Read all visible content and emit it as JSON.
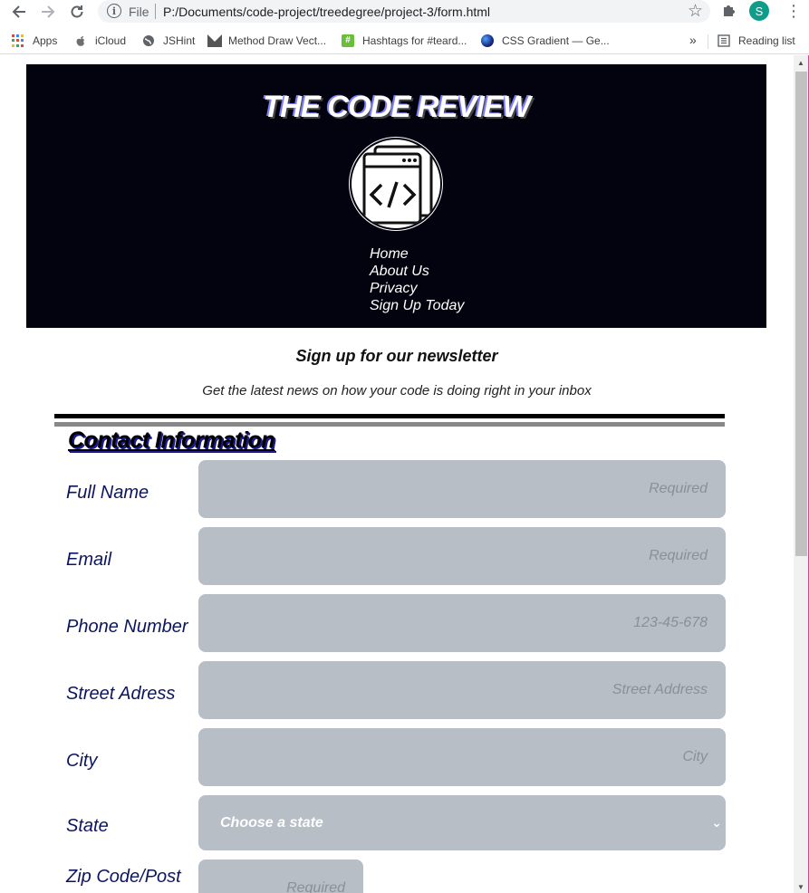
{
  "browser": {
    "file_label": "File",
    "url": "P:/Documents/code-project/treedegree/project-3/form.html",
    "profile_initial": "S",
    "bookmarks": [
      {
        "label": "Apps",
        "icon": "apps-grid-icon"
      },
      {
        "label": "iCloud",
        "icon": "apple-icon"
      },
      {
        "label": "JSHint",
        "icon": "globe-icon"
      },
      {
        "label": "Method Draw Vect...",
        "icon": "method-draw-icon"
      },
      {
        "label": "Hashtags for #teard...",
        "icon": "hashtag-icon"
      },
      {
        "label": "CSS Gradient — Ge...",
        "icon": "css-gradient-icon"
      }
    ],
    "more_label": "»",
    "reading_list": "Reading list"
  },
  "header": {
    "title": "THE CODE REVIEW",
    "logo_text": "</>",
    "nav": [
      "Home",
      "About Us",
      "Privacy",
      "Sign Up Today"
    ]
  },
  "newsletter": {
    "heading": "Sign up for our newsletter",
    "subheading": "Get the latest news on how your code is doing right in your inbox"
  },
  "contact": {
    "title": "Contact Information",
    "fields": [
      {
        "label": "Full Name",
        "placeholder": "Required"
      },
      {
        "label": "Email",
        "placeholder": "Required"
      },
      {
        "label": "Phone Number",
        "placeholder": "123-45-678"
      },
      {
        "label": "Street Adress",
        "placeholder": "Street Address"
      },
      {
        "label": "City",
        "placeholder": "City"
      }
    ],
    "state_label": "State",
    "state_value": "Choose a state",
    "zip_label": "Zip Code/Post",
    "zip_placeholder": "Required"
  },
  "colors": {
    "header_bg": "#03030f",
    "field_bg": "#b7bec6",
    "label_color": "#0c1560"
  }
}
